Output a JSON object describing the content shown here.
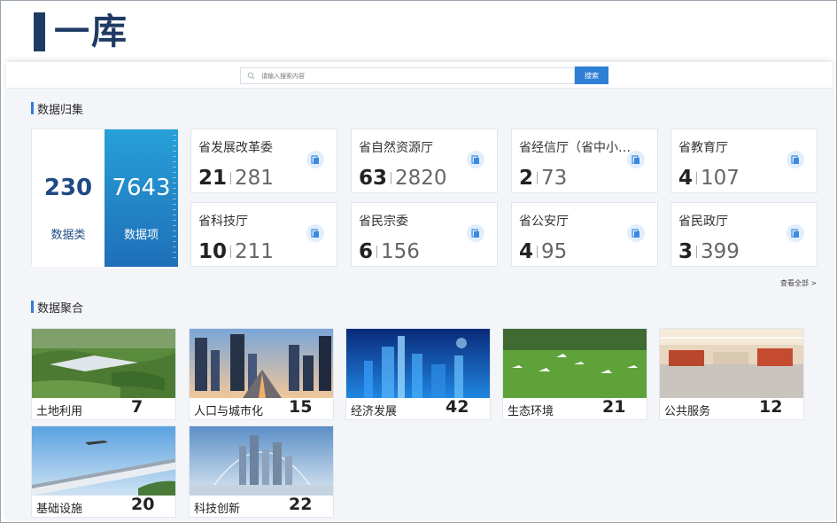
{
  "slide": {
    "title": "一库"
  },
  "search": {
    "placeholder": "请输入搜索内容",
    "button_label": "搜索"
  },
  "collection": {
    "title": "数据归集",
    "totals": [
      {
        "value": "230",
        "label": "数据类"
      },
      {
        "value": "7643",
        "label": "数据项"
      }
    ],
    "departments": [
      {
        "name": "省发展改革委",
        "a": "21",
        "b": "281"
      },
      {
        "name": "省自然资源厅",
        "a": "63",
        "b": "2820"
      },
      {
        "name": "省经信厅（省中小企业…",
        "a": "2",
        "b": "73"
      },
      {
        "name": "省教育厅",
        "a": "4",
        "b": "107"
      },
      {
        "name": "省科技厅",
        "a": "10",
        "b": "211"
      },
      {
        "name": "省民宗委",
        "a": "6",
        "b": "156"
      },
      {
        "name": "省公安厅",
        "a": "4",
        "b": "95"
      },
      {
        "name": "省民政厅",
        "a": "3",
        "b": "399"
      }
    ],
    "see_all": "查看全部 >"
  },
  "aggregation": {
    "title": "数据聚合",
    "topics": [
      {
        "name": "土地利用",
        "count": "7"
      },
      {
        "name": "人口与城市化",
        "count": "15"
      },
      {
        "name": "经济发展",
        "count": "42"
      },
      {
        "name": "生态环境",
        "count": "21"
      },
      {
        "name": "公共服务",
        "count": "12"
      },
      {
        "name": "基础设施",
        "count": "20"
      },
      {
        "name": "科技创新",
        "count": "22"
      }
    ]
  },
  "colors": {
    "brand": "#1f3b63",
    "accent": "#2f7fd6"
  }
}
